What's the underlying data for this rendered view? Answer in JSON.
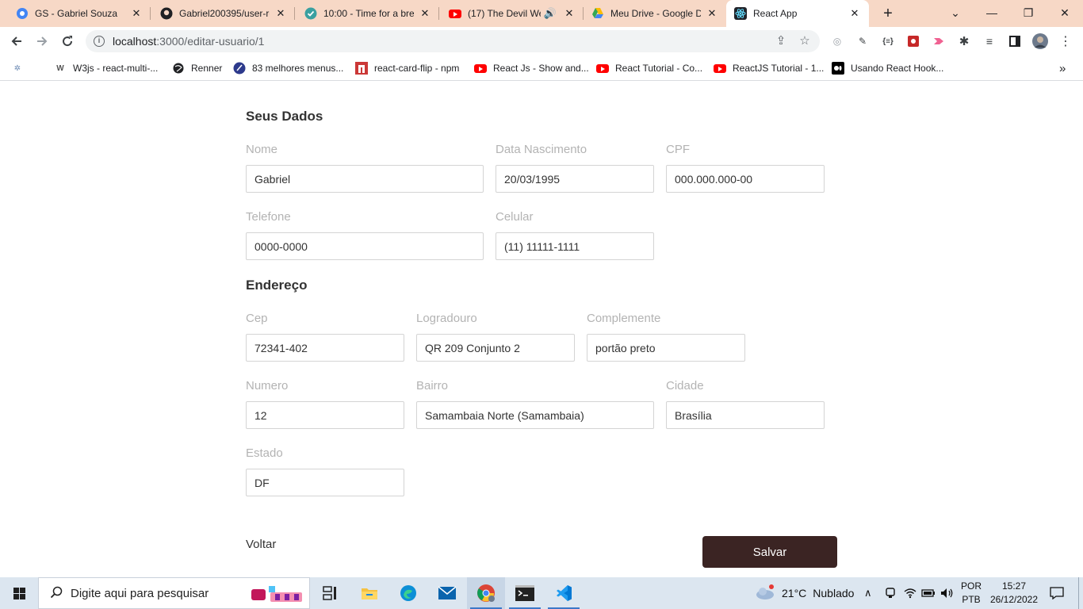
{
  "browser": {
    "tabs": [
      {
        "title": "GS - Gabriel Souza",
        "icon": "chrome-globe-icon"
      },
      {
        "title": "Gabriel200395/user-re",
        "icon": "github-icon"
      },
      {
        "title": "10:00 - Time for a brea",
        "icon": "check-circle-icon"
      },
      {
        "title": "(17) The Devil We",
        "icon": "youtube-icon"
      },
      {
        "title": "Meu Drive - Google D",
        "icon": "google-drive-icon"
      },
      {
        "title": "React App",
        "icon": "react-icon",
        "active": true
      }
    ],
    "url_host": "localhost",
    "url_path": ":3000/editar-usuario/1",
    "bookmarks": [
      {
        "label": "W3js - react-multi-..."
      },
      {
        "label": "Renner"
      },
      {
        "label": "83 melhores menus..."
      },
      {
        "label": "react-card-flip - npm"
      },
      {
        "label": "React Js - Show and..."
      },
      {
        "label": "React Tutorial - Co..."
      },
      {
        "label": "ReactJS Tutorial - 1..."
      },
      {
        "label": "Usando React Hook..."
      }
    ],
    "bookmarks_overflow": "»"
  },
  "form": {
    "personal_title": "Seus Dados",
    "address_title": "Endereço",
    "fields": {
      "nome": {
        "label": "Nome",
        "value": "Gabriel"
      },
      "data_nascimento": {
        "label": "Data Nascimento",
        "value": "20/03/1995"
      },
      "cpf": {
        "label": "CPF",
        "value": "000.000.000-00"
      },
      "telefone": {
        "label": "Telefone",
        "value": "0000-0000"
      },
      "celular": {
        "label": "Celular",
        "value": "(11) 11111-1111"
      },
      "cep": {
        "label": "Cep",
        "value": "72341-402"
      },
      "logradouro": {
        "label": "Logradouro",
        "value": "QR 209 Conjunto 2"
      },
      "complemento": {
        "label": "Complemente",
        "value": "portão preto"
      },
      "numero": {
        "label": "Numero",
        "value": "12"
      },
      "bairro": {
        "label": "Bairro",
        "value": "Samambaia Norte (Samambaia)"
      },
      "cidade": {
        "label": "Cidade",
        "value": "Brasília"
      },
      "estado": {
        "label": "Estado",
        "value": "DF"
      }
    },
    "back_label": "Voltar",
    "save_label": "Salvar"
  },
  "taskbar": {
    "search_placeholder": "Digite aqui para pesquisar",
    "weather_temp": "21°C",
    "weather_text": "Nublado",
    "lang_line1": "POR",
    "lang_line2": "PTB",
    "time": "15:27",
    "date": "26/12/2022"
  },
  "colors": {
    "tab_strip": "#f7d8c6",
    "save_button": "#3b2423",
    "label_gray": "#b3b3b3"
  }
}
